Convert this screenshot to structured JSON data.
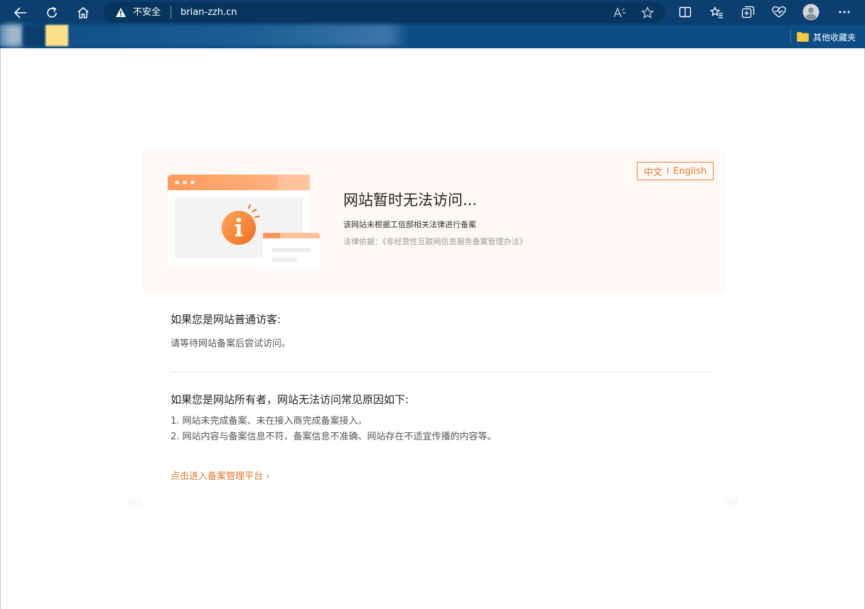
{
  "browser": {
    "security_label": "不安全",
    "url": "brian-zzh.cn",
    "bookmarks": {
      "other_folder_label": "其他收藏夹"
    }
  },
  "hero": {
    "lang_zh": "中文",
    "lang_sep": "I",
    "lang_en": "English",
    "title": "网站暂时无法访问...",
    "subtitle": "该网站未根据工信部相关法律进行备案",
    "law": "法律依据：《非经营性互联网信息服务备案管理办法》"
  },
  "visitor": {
    "title": "如果您是网站普通访客:",
    "text": "请等待网站备案后尝试访问。"
  },
  "owner": {
    "title": "如果您是网站所有者，网站无法访问常见原因如下:",
    "reasons": [
      "1. 网站未完成备案、未在接入商完成备案接入。",
      "2. 网站内容与备案信息不符、备案信息不准确、网站存在不适宜传播的内容等。"
    ]
  },
  "link": {
    "label": "点击进入备案管理平台 ›"
  },
  "colors": {
    "chrome_top": "#0c3f6f",
    "chrome_bookmarks": "#0c4d86",
    "accent": "#e87a2f",
    "hero_bg": "#fff8f5"
  }
}
